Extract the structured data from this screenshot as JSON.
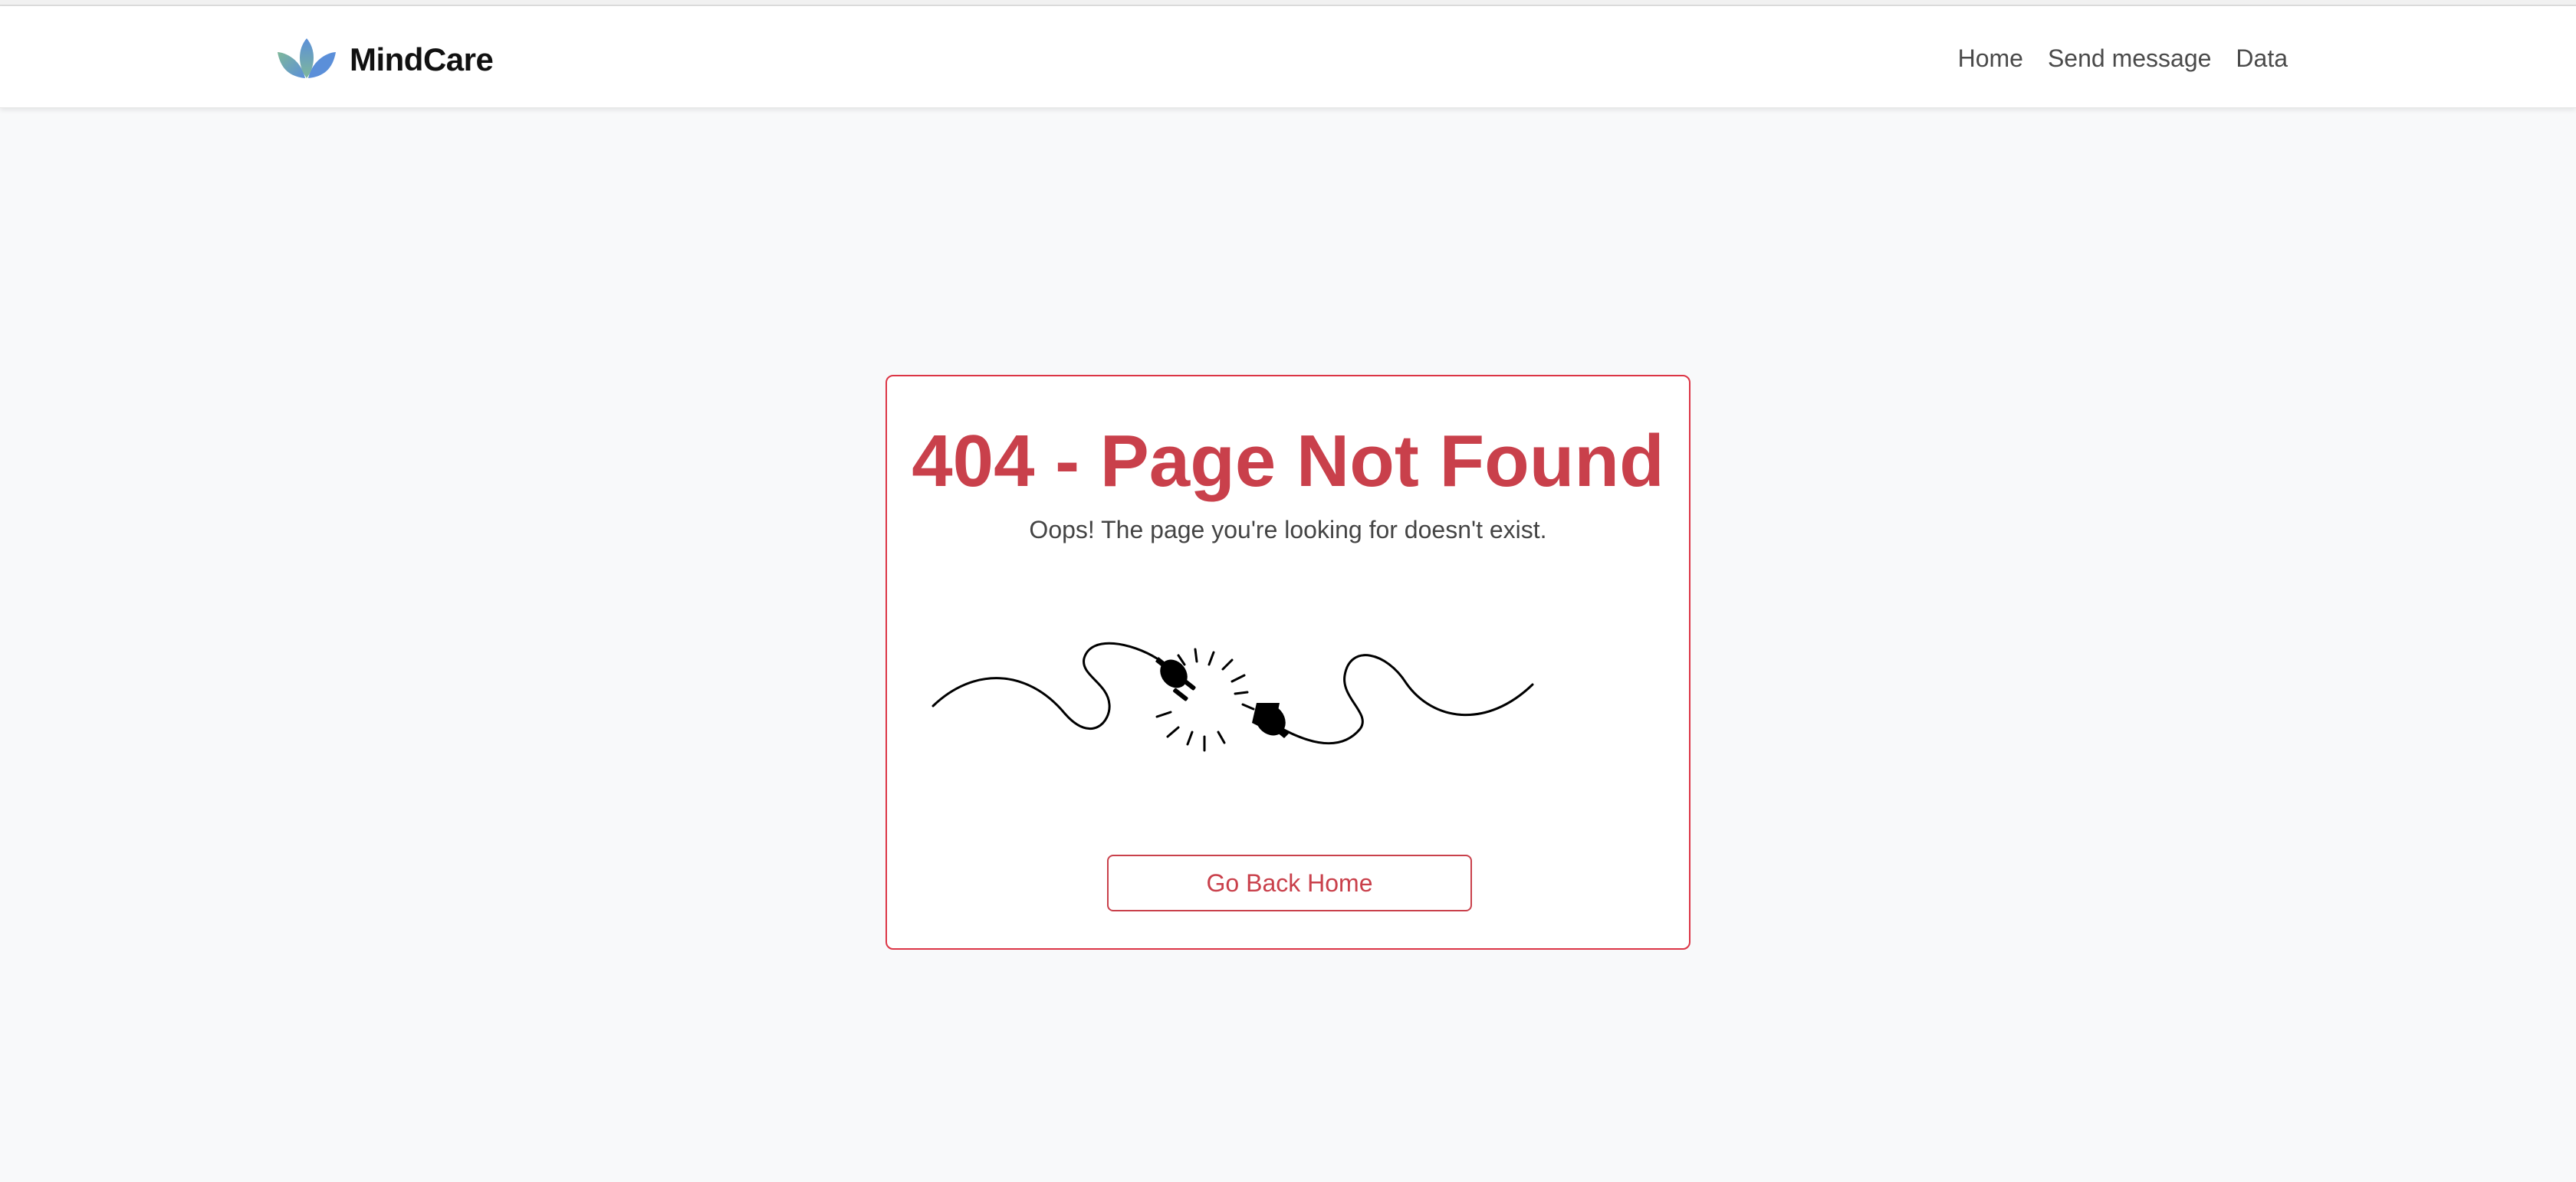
{
  "brand": {
    "name": "MindCare",
    "logo_icon": "lotus-icon"
  },
  "nav": {
    "items": [
      {
        "label": "Home"
      },
      {
        "label": "Send message"
      },
      {
        "label": "Data"
      }
    ]
  },
  "error": {
    "title": "404 - Page Not Found",
    "message": "Oops! The page you're looking for doesn't exist.",
    "illustration_icon": "unplugged-cable-icon",
    "button_label": "Go Back Home"
  },
  "colors": {
    "accent": "#dc3545",
    "text_accent": "#c9404b",
    "background": "#f8f9fa",
    "logo_blue": "#5b8fd9",
    "logo_green": "#7fb89a"
  }
}
